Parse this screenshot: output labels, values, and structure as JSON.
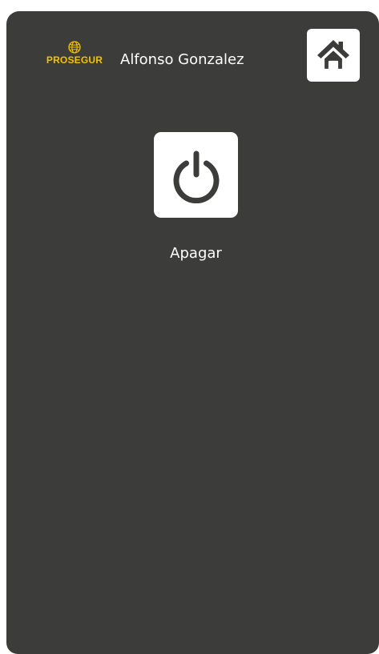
{
  "header": {
    "brand": "PROSEGUR",
    "user_name": "Alfonso Gonzalez",
    "home_icon": "home-icon"
  },
  "actions": [
    {
      "label": "Apagar",
      "icon": "power-icon"
    }
  ],
  "colors": {
    "background": "#3c3c3a",
    "brand": "#f2c200",
    "button": "#ffffff",
    "icon": "#3c3c3a"
  }
}
